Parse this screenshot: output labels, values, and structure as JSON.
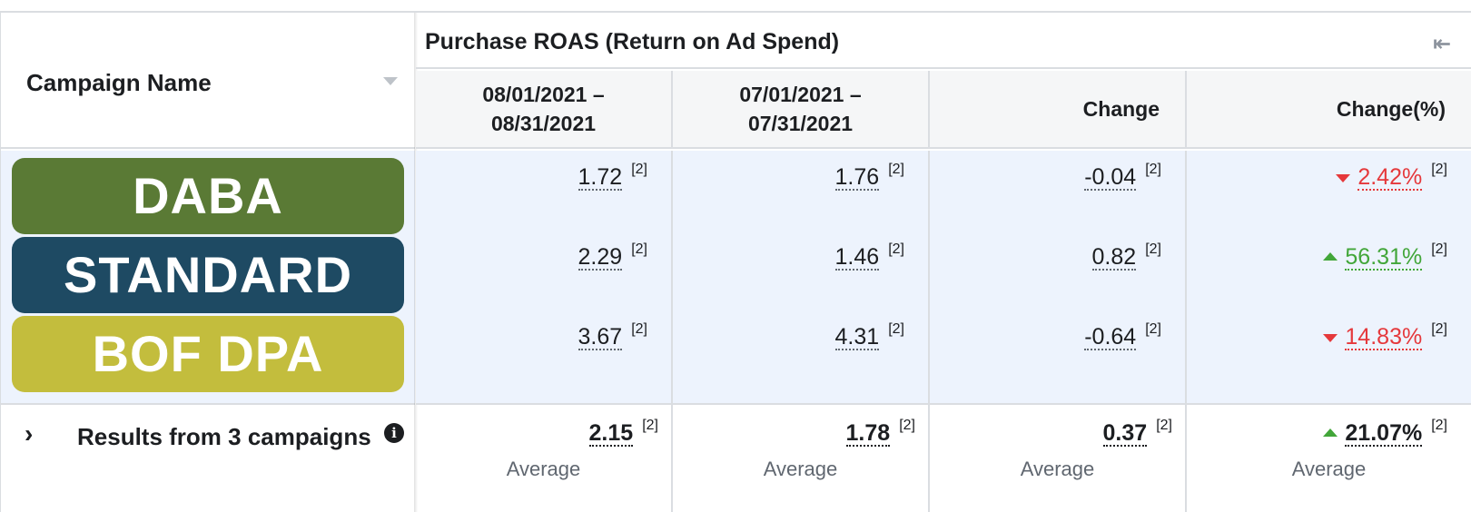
{
  "left": {
    "header": "Campaign Name",
    "campaigns": [
      {
        "name": "DABA",
        "color": "#5a7a35"
      },
      {
        "name": "STANDARD",
        "color": "#1e4a63"
      },
      {
        "name": "BOF DPA",
        "color": "#c3bd3d"
      }
    ],
    "footer_label": "Results from 3 campaigns",
    "info_glyph": "i"
  },
  "group_title": "Purchase ROAS (Return on Ad Spend)",
  "columns": [
    {
      "line1": "08/01/2021 –",
      "line2": "08/31/2021"
    },
    {
      "line1": "07/01/2021 –",
      "line2": "07/31/2021"
    },
    {
      "label": "Change"
    },
    {
      "label": "Change(%)"
    }
  ],
  "rows": [
    {
      "cur": "1.72",
      "prev": "1.76",
      "change": "-0.04",
      "pct": "2.42%",
      "pct_dir": "down"
    },
    {
      "cur": "2.29",
      "prev": "1.46",
      "change": "0.82",
      "pct": "56.31%",
      "pct_dir": "up"
    },
    {
      "cur": "3.67",
      "prev": "4.31",
      "change": "-0.64",
      "pct": "14.83%",
      "pct_dir": "down"
    }
  ],
  "footnote": "[2]",
  "totals": {
    "cur": "2.15",
    "prev": "1.78",
    "change": "0.37",
    "pct": "21.07%",
    "pct_dir": "up",
    "avg_label": "Average"
  },
  "colors": {
    "negative": "#e5383b",
    "positive": "#42a639"
  }
}
